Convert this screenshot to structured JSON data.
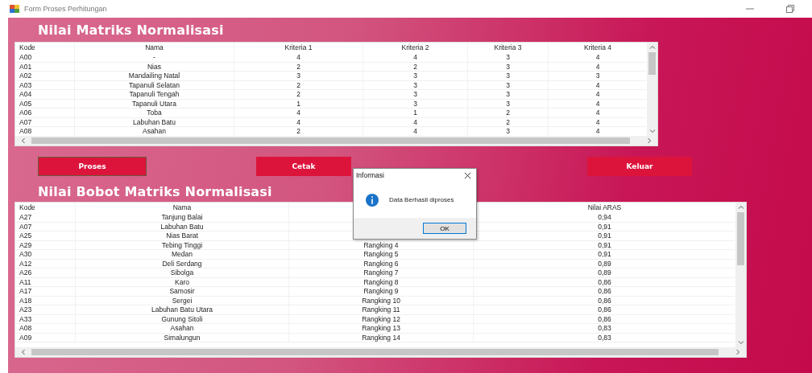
{
  "window": {
    "title": "Form Proses Perhitungan"
  },
  "matrix": {
    "title": "Nilai Matriks Normalisasi",
    "columns": [
      "Kode",
      "Nama",
      "Kriteria 1",
      "Kriteria 2",
      "Kriteria 3",
      "Kriteria 4"
    ],
    "rows": [
      [
        "A00",
        "-",
        "4",
        "4",
        "3",
        "4"
      ],
      [
        "A01",
        "Nias",
        "2",
        "2",
        "3",
        "4"
      ],
      [
        "A02",
        "Mandailing Natal",
        "3",
        "3",
        "3",
        "3"
      ],
      [
        "A03",
        "Tapanuli Selatan",
        "2",
        "3",
        "3",
        "4"
      ],
      [
        "A04",
        "Tapanuli Tengah",
        "2",
        "3",
        "3",
        "4"
      ],
      [
        "A05",
        "Tapanuli Utara",
        "1",
        "3",
        "3",
        "4"
      ],
      [
        "A06",
        "Toba",
        "4",
        "1",
        "2",
        "4"
      ],
      [
        "A07",
        "Labuhan Batu",
        "4",
        "4",
        "2",
        "4"
      ],
      [
        "A08",
        "Asahan",
        "2",
        "4",
        "3",
        "4"
      ]
    ]
  },
  "buttons": [
    {
      "label": "Proses",
      "focused": true
    },
    {
      "label": "Cetak",
      "focused": false
    },
    {
      "label": "Keluar",
      "focused": false
    }
  ],
  "ranking": {
    "title": "Nilai Bobot Matriks Normalisasi",
    "columns": [
      "Kode",
      "Nama",
      null,
      "Nilai ARAS"
    ],
    "rows": [
      [
        "A27",
        "Tanjung Balai",
        null,
        "0,94"
      ],
      [
        "A07",
        "Labuhan Batu",
        null,
        "0,91"
      ],
      [
        "A25",
        "Nias Barat",
        null,
        "0,91"
      ],
      [
        "A29",
        "Tebing Tinggi",
        "Rangking 4",
        "0,91"
      ],
      [
        "A30",
        "Medan",
        "Rangking 5",
        "0,91"
      ],
      [
        "A12",
        "Deli Serdang",
        "Rangking 6",
        "0,89"
      ],
      [
        "A26",
        "Sibolga",
        "Rangking 7",
        "0,89"
      ],
      [
        "A11",
        "Karo",
        "Rangking 8",
        "0,86"
      ],
      [
        "A17",
        "Samosir",
        "Rangking 9",
        "0,86"
      ],
      [
        "A18",
        "Sergei",
        "Rangking 10",
        "0,86"
      ],
      [
        "A23",
        "Labuhan Batu Utara",
        "Rangking 11",
        "0,86"
      ],
      [
        "A33",
        "Gunung Sitoli",
        "Rangking 12",
        "0,86"
      ],
      [
        "A08",
        "Asahan",
        "Rangking 13",
        "0,83"
      ],
      [
        "A09",
        "Simalungun",
        "Rangking 14",
        "0,83"
      ]
    ]
  },
  "dialog": {
    "title": "Informasi",
    "message": "Data Berhasil diproses",
    "button": "OK"
  }
}
